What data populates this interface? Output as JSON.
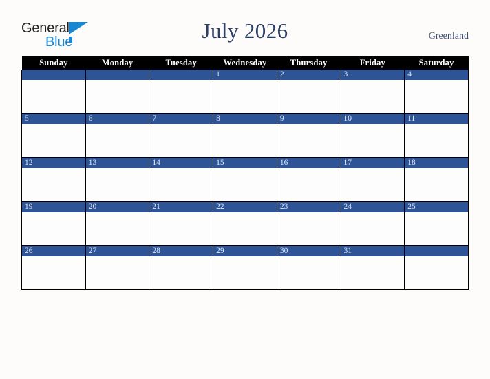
{
  "brand": {
    "name_part1": "General",
    "name_part2": "Blue"
  },
  "header": {
    "title": "July 2026",
    "region": "Greenland"
  },
  "colors": {
    "day_bar": "#2f5496",
    "weekday_header_bg": "#000000",
    "weekday_header_text": "#ffffff",
    "title_text": "#2a3f66",
    "region_text": "#3b4f73",
    "brand_blue": "#1787d4",
    "page_background": "#fdfcfa",
    "cell_background": "#fdfdfd",
    "grid_line": "#000000"
  },
  "calendar": {
    "weekdays": [
      "Sunday",
      "Monday",
      "Tuesday",
      "Wednesday",
      "Thursday",
      "Friday",
      "Saturday"
    ],
    "weeks": [
      [
        "",
        "",
        "",
        "1",
        "2",
        "3",
        "4"
      ],
      [
        "5",
        "6",
        "7",
        "8",
        "9",
        "10",
        "11"
      ],
      [
        "12",
        "13",
        "14",
        "15",
        "16",
        "17",
        "18"
      ],
      [
        "19",
        "20",
        "21",
        "22",
        "23",
        "24",
        "25"
      ],
      [
        "26",
        "27",
        "28",
        "29",
        "30",
        "31",
        ""
      ]
    ]
  }
}
